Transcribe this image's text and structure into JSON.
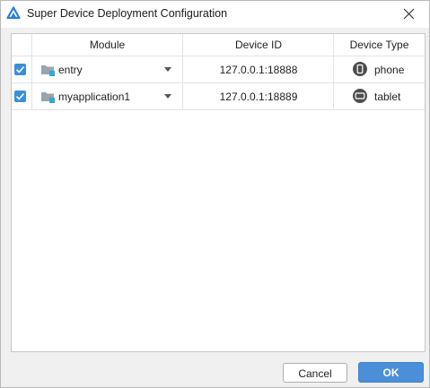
{
  "dialog": {
    "title": "Super Device Deployment Configuration",
    "close_icon": "close-icon",
    "logo_icon": "deveco-logo-icon"
  },
  "table": {
    "columns": [
      "Module",
      "Device ID",
      "Device Type"
    ],
    "rows": [
      {
        "checked": true,
        "module": "entry",
        "device_id": "127.0.0.1:18888",
        "device_type": "phone",
        "type_icon": "phone-icon"
      },
      {
        "checked": true,
        "module": "myapplication1",
        "device_id": "127.0.0.1:18889",
        "device_type": "tablet",
        "type_icon": "tablet-icon"
      }
    ]
  },
  "buttons": {
    "cancel": "Cancel",
    "ok": "OK"
  },
  "colors": {
    "accent": "#4a8fd8",
    "checkbox": "#3b8fd9"
  }
}
